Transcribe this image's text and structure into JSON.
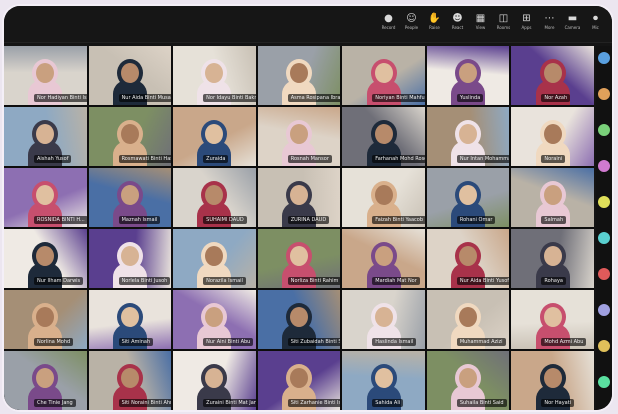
{
  "toolbar": {
    "items": [
      {
        "icon": "record-icon",
        "glyph": "●",
        "label": "Record"
      },
      {
        "icon": "people-icon",
        "glyph": "☺",
        "label": "People"
      },
      {
        "icon": "raise-hand-icon",
        "glyph": "✋",
        "label": "Raise"
      },
      {
        "icon": "react-icon",
        "glyph": "☻",
        "label": "React"
      },
      {
        "icon": "view-icon",
        "glyph": "▦",
        "label": "View"
      },
      {
        "icon": "rooms-icon",
        "glyph": "◫",
        "label": "Rooms"
      },
      {
        "icon": "apps-icon",
        "glyph": "⊞",
        "label": "Apps"
      },
      {
        "icon": "more-icon",
        "glyph": "⋯",
        "label": "More"
      },
      {
        "icon": "camera-icon",
        "glyph": "▬",
        "label": "Camera"
      },
      {
        "icon": "mic-icon",
        "glyph": "⏺",
        "label": "Mic"
      }
    ]
  },
  "participants": [
    {
      "name": "Nor Hadiyan Binti Ismail"
    },
    {
      "name": "Nur Aida Binti Musa"
    },
    {
      "name": "Nor Idayu Binti Bakri"
    },
    {
      "name": "Asma Rosipana Ibrahim"
    },
    {
      "name": "Noriyan Binti Mahfudz"
    },
    {
      "name": "Yuslinda"
    },
    {
      "name": "Nor Azah"
    },
    {
      "name": "Aishah Yusof"
    },
    {
      "name": "Rosmawati Binti Hassan"
    },
    {
      "name": "Zuraida"
    },
    {
      "name": "Rosnah Mansor"
    },
    {
      "name": "Farhanah Mohd Rosdi"
    },
    {
      "name": "Nur Intan Mohammad"
    },
    {
      "name": "Noraini"
    },
    {
      "name": "ROSNIDA BINTI H..."
    },
    {
      "name": "Maznah Ismail"
    },
    {
      "name": "SUHAIMI DAUD"
    },
    {
      "name": "ZURINA DAUD"
    },
    {
      "name": "Faizah Binti Yaacob"
    },
    {
      "name": "Rohani Omar"
    },
    {
      "name": "Salmah"
    },
    {
      "name": "Nur Ilham Darwis"
    },
    {
      "name": "Norlela Binti Jusoh"
    },
    {
      "name": "Norazila Ismail"
    },
    {
      "name": "Norliza Binti Rahim"
    },
    {
      "name": "Mardiah Mat Nor"
    },
    {
      "name": "Nur Aida Binti Yusof"
    },
    {
      "name": "Rohaya"
    },
    {
      "name": "Norlina Mohd"
    },
    {
      "name": "Siti Aminah"
    },
    {
      "name": "Nur Aini Binti Abu"
    },
    {
      "name": "Siti Zubaidah Binti Salleh"
    },
    {
      "name": "Haslinda Ismail"
    },
    {
      "name": "Muhammad Azizi"
    },
    {
      "name": "Mohd Azmi Abu"
    },
    {
      "name": "Che Tinie Jang"
    },
    {
      "name": "Siti Noraini Binti Ahmad"
    },
    {
      "name": "Zuraini Binti Mat Jan"
    },
    {
      "name": "Siti Zarhanie Binti Ismail"
    },
    {
      "name": "Sahida Ali"
    },
    {
      "name": "Suhaila Binti Said"
    },
    {
      "name": "Nor Hayati"
    }
  ],
  "colors": {
    "background": "#ece6f0",
    "window": "#141414",
    "muted_mic": "#e05a5a"
  },
  "palettes": {
    "walls": [
      "#d9d4cc",
      "#c8c0b4",
      "#e6e1d8",
      "#9aa0a8",
      "#b9b2a6",
      "#efeae4",
      "#5a3f8f",
      "#8ea9c3",
      "#7d8f63",
      "#c9a78a",
      "#ddd3c7",
      "#6f6f78",
      "#a58f76",
      "#e9e3dc",
      "#8d6fb2",
      "#4a6fa5"
    ],
    "heads": [
      "#c9a07f",
      "#b78a6a",
      "#d7b394",
      "#a87a5a",
      "#e0c0a0"
    ],
    "scarves": [
      "#e8c8d4",
      "#3a3a4a",
      "#c74f6e",
      "#1e2a3a",
      "#d9b08c",
      "#7a4a8a",
      "#efe2e8",
      "#2b4a7a",
      "#a8324a",
      "#f0d9c0"
    ],
    "avatars": [
      "#5aa0e0",
      "#e0a05a",
      "#7ad07a",
      "#d07ad0",
      "#e0e05a",
      "#5ad0d0",
      "#e05a5a",
      "#a0a0e0",
      "#e0c05a",
      "#5ae0a0"
    ]
  }
}
